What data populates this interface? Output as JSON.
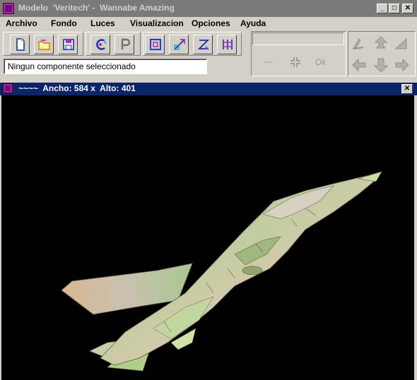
{
  "app": {
    "title": "Modelo  'Veritech' -  Wannabe Amazing",
    "window_buttons": {
      "minimize": "_",
      "maximize": "□",
      "close": "✕"
    }
  },
  "menu": [
    "Archivo",
    "Fondo",
    "Luces",
    "Visualizacion",
    "Opciones",
    "Ayuda"
  ],
  "toolbar": {
    "groups": [
      [
        "new-file-icon",
        "open-file-icon",
        "save-file-icon"
      ],
      [
        "color-icon",
        "properties-icon"
      ],
      [
        "select-box-icon",
        "transform-icon",
        "scale-icon",
        "mirror-icon"
      ]
    ]
  },
  "status": {
    "text": "Ningun componente seleccionado"
  },
  "edit_panel": {
    "value": "",
    "minus_label": "—",
    "plus_icon": "plus-cross-icon",
    "ok_label": "Ok"
  },
  "nav_panel": {
    "icons": [
      "arrow-upleft-icon",
      "arrow-up-icon",
      "arrow-upright-icon",
      "arrow-left-icon",
      "arrow-down-icon",
      "arrow-right-icon"
    ]
  },
  "subwindow": {
    "title": "~~~~  Ancho: 584 x  Alto: 401",
    "close": "✕"
  },
  "colors": {
    "titlebar_inactive": "#7a7a7a",
    "titlebar_active": "#0a246a",
    "viewport_bg": "#000000"
  }
}
